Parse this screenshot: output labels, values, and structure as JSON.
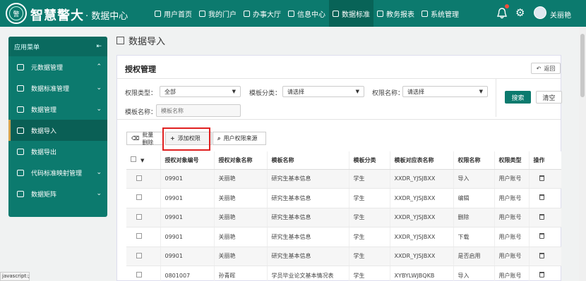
{
  "header": {
    "brand": "智慧警大",
    "subtitle": "· 数据中心",
    "logo_text": "警",
    "nav": [
      {
        "label": "用户首页"
      },
      {
        "label": "我的门户"
      },
      {
        "label": "办事大厅"
      },
      {
        "label": "信息中心"
      },
      {
        "label": "数据标准"
      },
      {
        "label": "教务报表"
      },
      {
        "label": "系统管理"
      }
    ],
    "active_nav": "数据标准",
    "user": "关丽艳",
    "accent": "#0c7a6e"
  },
  "sidebar": {
    "title": "应用菜单",
    "items": [
      {
        "label": "元数据管理"
      },
      {
        "label": "数据标准管理"
      },
      {
        "label": "数据管理"
      },
      {
        "label": "数据导入"
      },
      {
        "label": "数据导出"
      },
      {
        "label": "代码标准映射管理"
      },
      {
        "label": "数据矩阵"
      }
    ],
    "active": "数据导入"
  },
  "page": {
    "breadcrumb": "数据导入",
    "panel_title": "授权管理",
    "back_label": "返回"
  },
  "filters": {
    "type_label": "权限类型：",
    "type_value": "全部",
    "template_cat_label": "模板分类：",
    "template_cat_value": "请选择",
    "perm_name_label": "权限名称：",
    "perm_name_value": "请选择",
    "template_name_label": "模板名称：",
    "template_name_placeholder": "模板名称",
    "search_label": "搜索",
    "clear_label": "清空"
  },
  "toolbar": {
    "batch_delete": "批量删除",
    "add_permission": "添加权限",
    "user_source": "用户权限来源"
  },
  "table": {
    "headers": [
      "授权对象编号",
      "授权对象名称",
      "模板名称",
      "模板分类",
      "模板对应表名称",
      "权限名称",
      "权限类型",
      "操作"
    ],
    "rows": [
      [
        "09901",
        "关丽艳",
        "研究生基本信息",
        "学生",
        "XXDR_YJSJBXX",
        "导入",
        "用户账号"
      ],
      [
        "09901",
        "关丽艳",
        "研究生基本信息",
        "学生",
        "XXDR_YJSJBXX",
        "编辑",
        "用户账号"
      ],
      [
        "09901",
        "关丽艳",
        "研究生基本信息",
        "学生",
        "XXDR_YJSJBXX",
        "删除",
        "用户账号"
      ],
      [
        "09901",
        "关丽艳",
        "研究生基本信息",
        "学生",
        "XXDR_YJSJBXX",
        "下载",
        "用户账号"
      ],
      [
        "09901",
        "关丽艳",
        "研究生基本信息",
        "学生",
        "XXDR_YJSJBXX",
        "是否启用",
        "用户账号"
      ],
      [
        "0801007",
        "孙青晖",
        "学员毕业论文基本情况表",
        "学生",
        "XYBYLWJBQKB",
        "导入",
        "用户账号"
      ]
    ]
  },
  "status_bar": "javascript:;"
}
